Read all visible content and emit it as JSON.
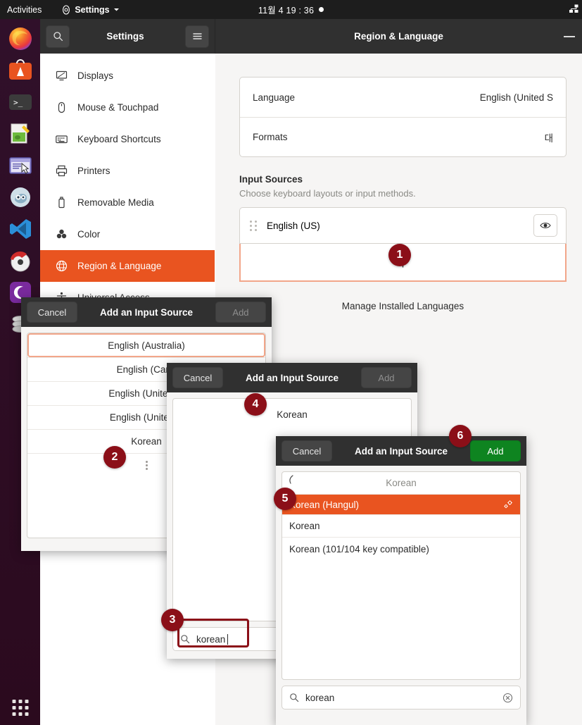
{
  "topbar": {
    "activities": "Activities",
    "app_menu": "Settings",
    "clock": "11월 4  19 : 36",
    "icons": {
      "app": "settings-gear-icon",
      "dropdown": "chevron-down-icon",
      "network": "network-icon",
      "dot": "notification-dot"
    }
  },
  "dock": {
    "items": [
      {
        "name": "firefox",
        "label": "Firefox"
      },
      {
        "name": "ubuntu-software",
        "label": "Ubuntu Software"
      },
      {
        "name": "terminal",
        "label": "Terminal"
      },
      {
        "name": "text-editor",
        "label": "Text Editor"
      },
      {
        "name": "remote-desktop",
        "label": "Remote Desktop"
      },
      {
        "name": "gimp",
        "label": "GIMP"
      },
      {
        "name": "vscode",
        "label": "Visual Studio Code"
      },
      {
        "name": "help",
        "label": "Help"
      },
      {
        "name": "moon-app",
        "label": "Moon App"
      },
      {
        "name": "disks",
        "label": "Disks"
      }
    ],
    "show_apps": "show-applications-grid"
  },
  "settings_window": {
    "left_header": {
      "search_icon": "search-icon",
      "title": "Settings",
      "menu_icon": "hamburger-menu-icon"
    },
    "right_header": {
      "title": "Region & Language",
      "minimize": "minimize-button"
    },
    "sidebar": {
      "items": [
        {
          "label": "Displays",
          "icon": "display-icon",
          "active": false
        },
        {
          "label": "Mouse & Touchpad",
          "icon": "mouse-icon",
          "active": false
        },
        {
          "label": "Keyboard Shortcuts",
          "icon": "keyboard-icon",
          "active": false
        },
        {
          "label": "Printers",
          "icon": "printer-icon",
          "active": false
        },
        {
          "label": "Removable Media",
          "icon": "usb-drive-icon",
          "active": false
        },
        {
          "label": "Color",
          "icon": "color-icon",
          "active": false
        },
        {
          "label": "Region & Language",
          "icon": "globe-icon",
          "active": true
        },
        {
          "label": "Universal Access",
          "icon": "accessibility-icon",
          "active": false
        }
      ]
    },
    "content": {
      "rows": [
        {
          "label": "Language",
          "value": "English (United S"
        },
        {
          "label": "Formats",
          "value": "대"
        }
      ],
      "input_sources_title": "Input Sources",
      "input_sources_sub": "Choose keyboard layouts or input methods.",
      "sources": [
        {
          "label": "English (US)",
          "icons": {
            "drag": "drag-handle-icon",
            "preview": "eye-preview-icon"
          }
        }
      ],
      "add_icon": "plus-icon",
      "manage_label": "Manage Installed Languages"
    }
  },
  "dialog1": {
    "cancel": "Cancel",
    "title": "Add an Input Source",
    "add": "Add",
    "items": [
      "English (Australia)",
      "English (Cana",
      "English (United Ki",
      "English (United S",
      "Korean"
    ],
    "more_icon": "more-vertical-icon"
  },
  "dialog2": {
    "cancel": "Cancel",
    "title": "Add an Input Source",
    "add": "Add",
    "items": [
      "Korean"
    ],
    "search": {
      "icon": "search-icon",
      "value": "korean"
    }
  },
  "dialog3": {
    "cancel": "Cancel",
    "title": "Add an Input Source",
    "add": "Add",
    "list_header": "Korean",
    "back_icon": "back-chevron-icon",
    "items": [
      {
        "label": "Korean (Hangul)",
        "selected": true,
        "trailing_icon": "preferences-gear-icon"
      },
      {
        "label": "Korean",
        "selected": false,
        "trailing_icon": ""
      },
      {
        "label": "Korean (101/104 key compatible)",
        "selected": false,
        "trailing_icon": ""
      }
    ],
    "search": {
      "icon": "search-icon",
      "value": "korean",
      "clear_icon": "clear-circle-icon"
    }
  },
  "badges": [
    {
      "n": "1"
    },
    {
      "n": "2"
    },
    {
      "n": "3"
    },
    {
      "n": "4"
    },
    {
      "n": "5"
    },
    {
      "n": "6"
    }
  ],
  "colors": {
    "accent": "#e95420",
    "badge": "#8b0f18",
    "add_green": "#0e8420",
    "topbar": "#1d1d1d",
    "header": "#303030"
  }
}
